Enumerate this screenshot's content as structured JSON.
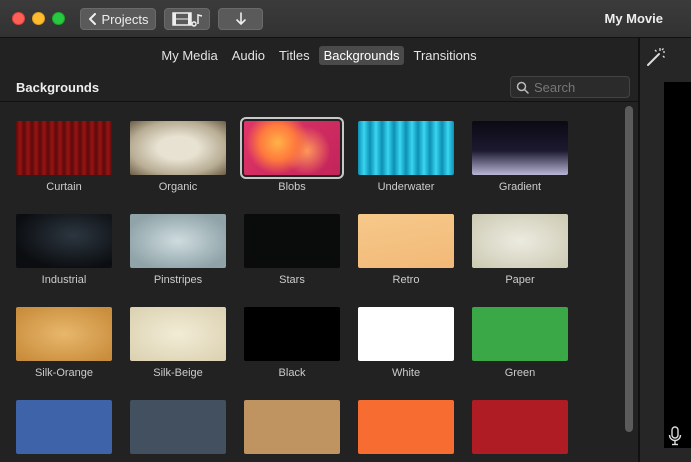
{
  "window": {
    "title": "My Movie",
    "projects_label": "Projects"
  },
  "tabs": [
    {
      "label": "My Media",
      "active": false
    },
    {
      "label": "Audio",
      "active": false
    },
    {
      "label": "Titles",
      "active": false
    },
    {
      "label": "Backgrounds",
      "active": true
    },
    {
      "label": "Transitions",
      "active": false
    }
  ],
  "browser": {
    "header_title": "Backgrounds",
    "search_placeholder": "Search"
  },
  "items": [
    {
      "label": "Curtain",
      "selected": false,
      "fill": "repeating-linear-gradient(90deg,#5a0a0a 0px,#9a1414 4px,#5a0a0a 8px)"
    },
    {
      "label": "Organic",
      "selected": false,
      "fill": "radial-gradient(ellipse at center,#e8e2d2 30%,#b8ad94 70%,#6b5d48 100%)"
    },
    {
      "label": "Blobs",
      "selected": true,
      "fill": "radial-gradient(circle at 35% 40%,#ffb347 0%,#ff7a3d 25%,transparent 45%),radial-gradient(circle at 65% 55%,#ff9a5a 0%,transparent 35%),linear-gradient(135deg,#e0356a,#c2245a)"
    },
    {
      "label": "Underwater",
      "selected": false,
      "fill": "repeating-linear-gradient(90deg,#0c8fb3 0px,#39d6f0 6px,#0c8fb3 12px)"
    },
    {
      "label": "Gradient",
      "selected": false,
      "fill": "linear-gradient(#0b0a12 0%,#1c1930 55%,#b9b6d6 100%)"
    },
    {
      "label": "Industrial",
      "selected": false,
      "fill": "radial-gradient(ellipse at 60% 40%,#2c3640 0%,#0b0d10 75%)"
    },
    {
      "label": "Pinstripes",
      "selected": false,
      "fill": "radial-gradient(ellipse at center,#cfdcdf 0%,#8fa3a8 80%)"
    },
    {
      "label": "Stars",
      "selected": false,
      "fill": "#0a0c0c"
    },
    {
      "label": "Retro",
      "selected": false,
      "fill": "linear-gradient(170deg,#f6c98a,#f2b978)"
    },
    {
      "label": "Paper",
      "selected": false,
      "fill": "radial-gradient(ellipse at center,#ecebe0 0%,#cfccb6 90%)"
    },
    {
      "label": "Silk-Orange",
      "selected": false,
      "fill": "radial-gradient(ellipse at center,#e8b76c 0%,#c98d3c 90%)"
    },
    {
      "label": "Silk-Beige",
      "selected": false,
      "fill": "radial-gradient(ellipse at center,#f2ecd6 0%,#ddd3b4 90%)"
    },
    {
      "label": "Black",
      "selected": false,
      "fill": "#000000"
    },
    {
      "label": "White",
      "selected": false,
      "fill": "#ffffff"
    },
    {
      "label": "Green",
      "selected": false,
      "fill": "#3aa847"
    },
    {
      "label": "",
      "selected": false,
      "fill": "#3e63a8"
    },
    {
      "label": "",
      "selected": false,
      "fill": "#435060"
    },
    {
      "label": "",
      "selected": false,
      "fill": "#c09460"
    },
    {
      "label": "",
      "selected": false,
      "fill": "#f76d31"
    },
    {
      "label": "",
      "selected": false,
      "fill": "#b01c23"
    }
  ],
  "icons": {
    "back": "chevron-left-icon",
    "media_toggle": "film-music-icon",
    "import": "arrow-down-icon",
    "search": "search-icon",
    "magic_wand": "magic-wand-icon",
    "mic": "microphone-icon"
  }
}
